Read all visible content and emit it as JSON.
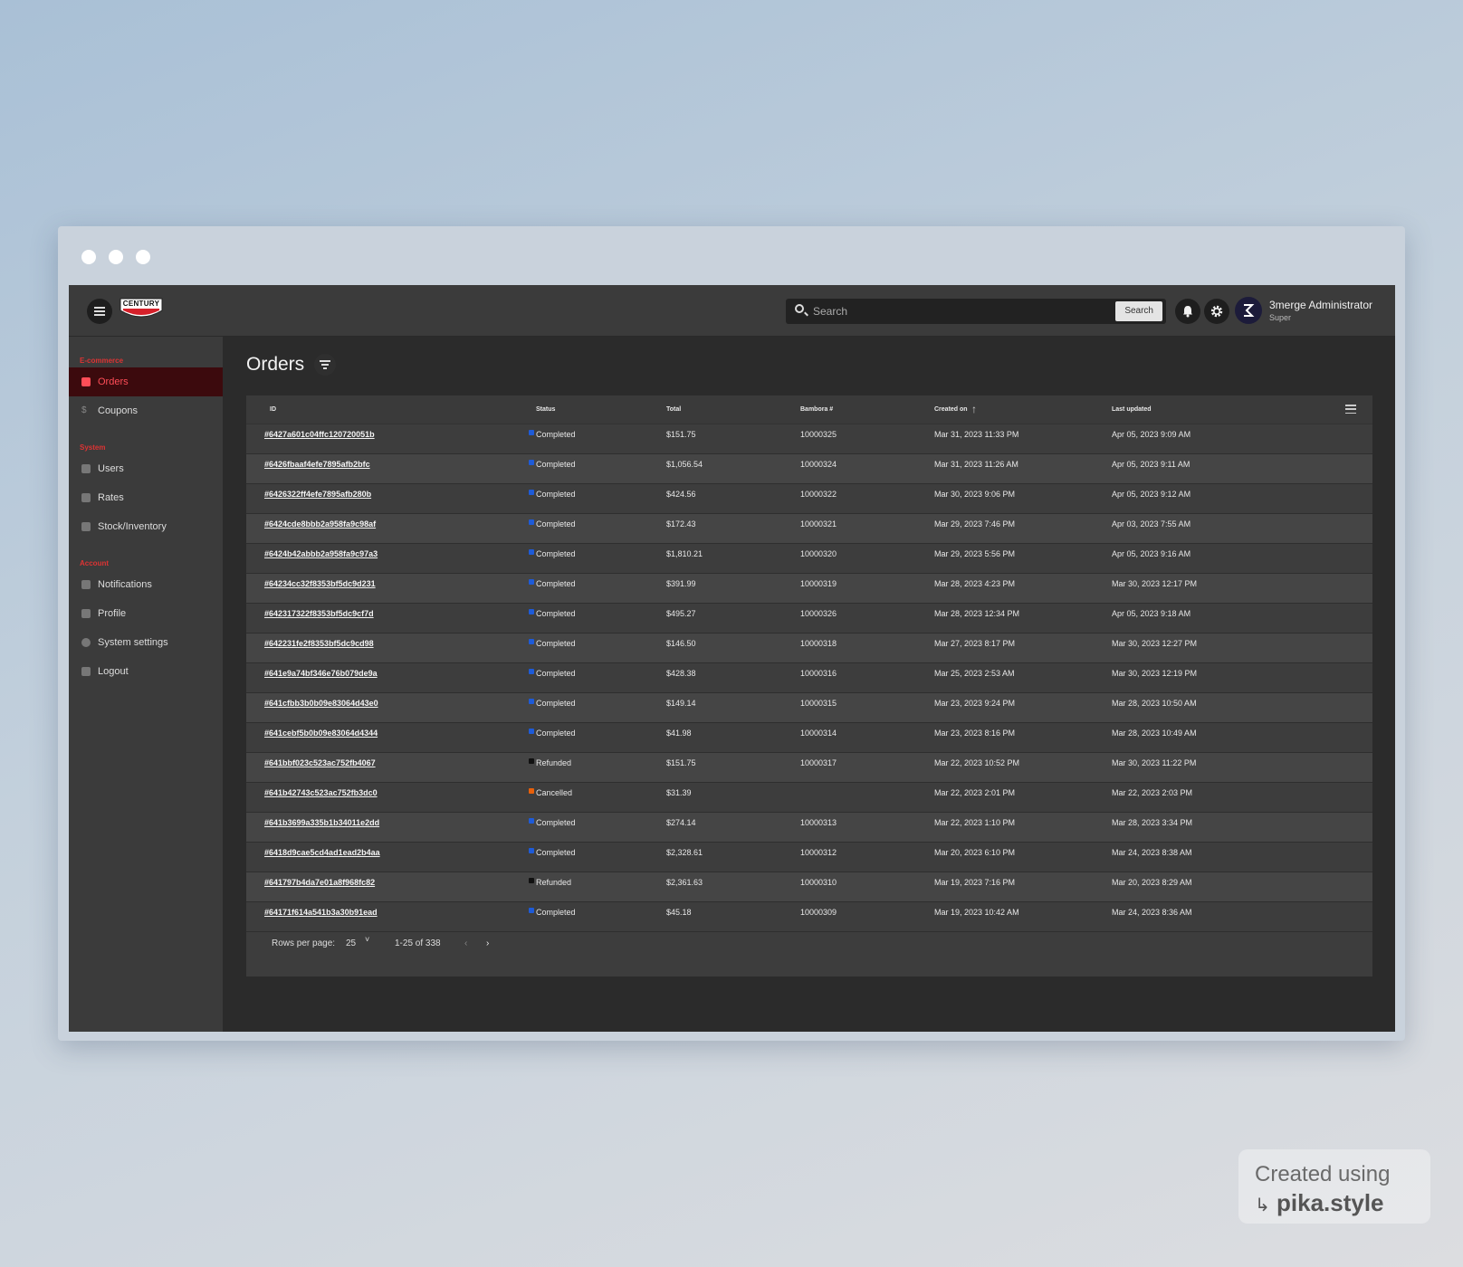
{
  "window": {
    "controls": [
      "close",
      "minimize",
      "maximize"
    ]
  },
  "header": {
    "logo_text": "CENTURY",
    "search": {
      "placeholder": "Search",
      "value": "",
      "button_label": "Search"
    },
    "user": {
      "name": "3merge Administrator",
      "role": "Super"
    },
    "icons": [
      "menu-icon",
      "bell-icon",
      "gear-icon"
    ]
  },
  "sidebar": {
    "sections": [
      {
        "title": "E-commerce",
        "items": [
          {
            "label": "Orders",
            "icon": "orders-icon",
            "active": true
          },
          {
            "label": "Coupons",
            "icon": "coupon-icon",
            "active": false
          }
        ]
      },
      {
        "title": "System",
        "items": [
          {
            "label": "Users",
            "icon": "users-icon",
            "active": false
          },
          {
            "label": "Rates",
            "icon": "truck-icon",
            "active": false
          },
          {
            "label": "Stock/Inventory",
            "icon": "warehouse-icon",
            "active": false
          }
        ]
      },
      {
        "title": "Account",
        "items": [
          {
            "label": "Notifications",
            "icon": "bell-icon",
            "active": false
          },
          {
            "label": "Profile",
            "icon": "profile-icon",
            "active": false
          },
          {
            "label": "System settings",
            "icon": "gear-icon",
            "active": false
          },
          {
            "label": "Logout",
            "icon": "logout-icon",
            "active": false
          }
        ]
      }
    ]
  },
  "main": {
    "title": "Orders",
    "table": {
      "columns": [
        "ID",
        "Status",
        "Total",
        "Bambora #",
        "Created on",
        "Last updated"
      ],
      "sort": {
        "column": "Created on",
        "direction": "ascending-arrow"
      },
      "status_colors": {
        "Completed": "#1e5bd8",
        "Refunded": "#111111",
        "Cancelled": "#e8600a"
      },
      "rows": [
        {
          "id": "#6427a601c04ffc120720051b",
          "status": "Completed",
          "total": "$151.75",
          "bambora": "10000325",
          "created": "Mar 31, 2023 11:33 PM",
          "updated": "Apr 05, 2023 9:09 AM"
        },
        {
          "id": "#6426fbaaf4efe7895afb2bfc",
          "status": "Completed",
          "total": "$1,056.54",
          "bambora": "10000324",
          "created": "Mar 31, 2023 11:26 AM",
          "updated": "Apr 05, 2023 9:11 AM"
        },
        {
          "id": "#6426322ff4efe7895afb280b",
          "status": "Completed",
          "total": "$424.56",
          "bambora": "10000322",
          "created": "Mar 30, 2023 9:06 PM",
          "updated": "Apr 05, 2023 9:12 AM"
        },
        {
          "id": "#6424cde8bbb2a958fa9c98af",
          "status": "Completed",
          "total": "$172.43",
          "bambora": "10000321",
          "created": "Mar 29, 2023 7:46 PM",
          "updated": "Apr 03, 2023 7:55 AM"
        },
        {
          "id": "#6424b42abbb2a958fa9c97a3",
          "status": "Completed",
          "total": "$1,810.21",
          "bambora": "10000320",
          "created": "Mar 29, 2023 5:56 PM",
          "updated": "Apr 05, 2023 9:16 AM"
        },
        {
          "id": "#64234cc32f8353bf5dc9d231",
          "status": "Completed",
          "total": "$391.99",
          "bambora": "10000319",
          "created": "Mar 28, 2023 4:23 PM",
          "updated": "Mar 30, 2023 12:17 PM"
        },
        {
          "id": "#642317322f8353bf5dc9cf7d",
          "status": "Completed",
          "total": "$495.27",
          "bambora": "10000326",
          "created": "Mar 28, 2023 12:34 PM",
          "updated": "Apr 05, 2023 9:18 AM"
        },
        {
          "id": "#642231fe2f8353bf5dc9cd98",
          "status": "Completed",
          "total": "$146.50",
          "bambora": "10000318",
          "created": "Mar 27, 2023 8:17 PM",
          "updated": "Mar 30, 2023 12:27 PM"
        },
        {
          "id": "#641e9a74bf346e76b079de9a",
          "status": "Completed",
          "total": "$428.38",
          "bambora": "10000316",
          "created": "Mar 25, 2023 2:53 AM",
          "updated": "Mar 30, 2023 12:19 PM"
        },
        {
          "id": "#641cfbb3b0b09e83064d43e0",
          "status": "Completed",
          "total": "$149.14",
          "bambora": "10000315",
          "created": "Mar 23, 2023 9:24 PM",
          "updated": "Mar 28, 2023 10:50 AM"
        },
        {
          "id": "#641cebf5b0b09e83064d4344",
          "status": "Completed",
          "total": "$41.98",
          "bambora": "10000314",
          "created": "Mar 23, 2023 8:16 PM",
          "updated": "Mar 28, 2023 10:49 AM"
        },
        {
          "id": "#641bbf023c523ac752fb4067",
          "status": "Refunded",
          "total": "$151.75",
          "bambora": "10000317",
          "created": "Mar 22, 2023 10:52 PM",
          "updated": "Mar 30, 2023 11:22 PM"
        },
        {
          "id": "#641b42743c523ac752fb3dc0",
          "status": "Cancelled",
          "total": "$31.39",
          "bambora": "",
          "created": "Mar 22, 2023 2:01 PM",
          "updated": "Mar 22, 2023 2:03 PM"
        },
        {
          "id": "#641b3699a335b1b34011e2dd",
          "status": "Completed",
          "total": "$274.14",
          "bambora": "10000313",
          "created": "Mar 22, 2023 1:10 PM",
          "updated": "Mar 28, 2023 3:34 PM"
        },
        {
          "id": "#6418d9cae5cd4ad1ead2b4aa",
          "status": "Completed",
          "total": "$2,328.61",
          "bambora": "10000312",
          "created": "Mar 20, 2023 6:10 PM",
          "updated": "Mar 24, 2023 8:38 AM"
        },
        {
          "id": "#641797b4da7e01a8f968fc82",
          "status": "Refunded",
          "total": "$2,361.63",
          "bambora": "10000310",
          "created": "Mar 19, 2023 7:16 PM",
          "updated": "Mar 20, 2023 8:29 AM"
        },
        {
          "id": "#64171f614a541b3a30b91ead",
          "status": "Completed",
          "total": "$45.18",
          "bambora": "10000309",
          "created": "Mar 19, 2023 10:42 AM",
          "updated": "Mar 24, 2023 8:36 AM"
        }
      ]
    },
    "pagination": {
      "rows_per_page_label": "Rows per page:",
      "rows_per_page": "25",
      "range": "1-25 of 338"
    }
  },
  "watermark": {
    "line1": "Created using",
    "line2": "pika.style"
  }
}
